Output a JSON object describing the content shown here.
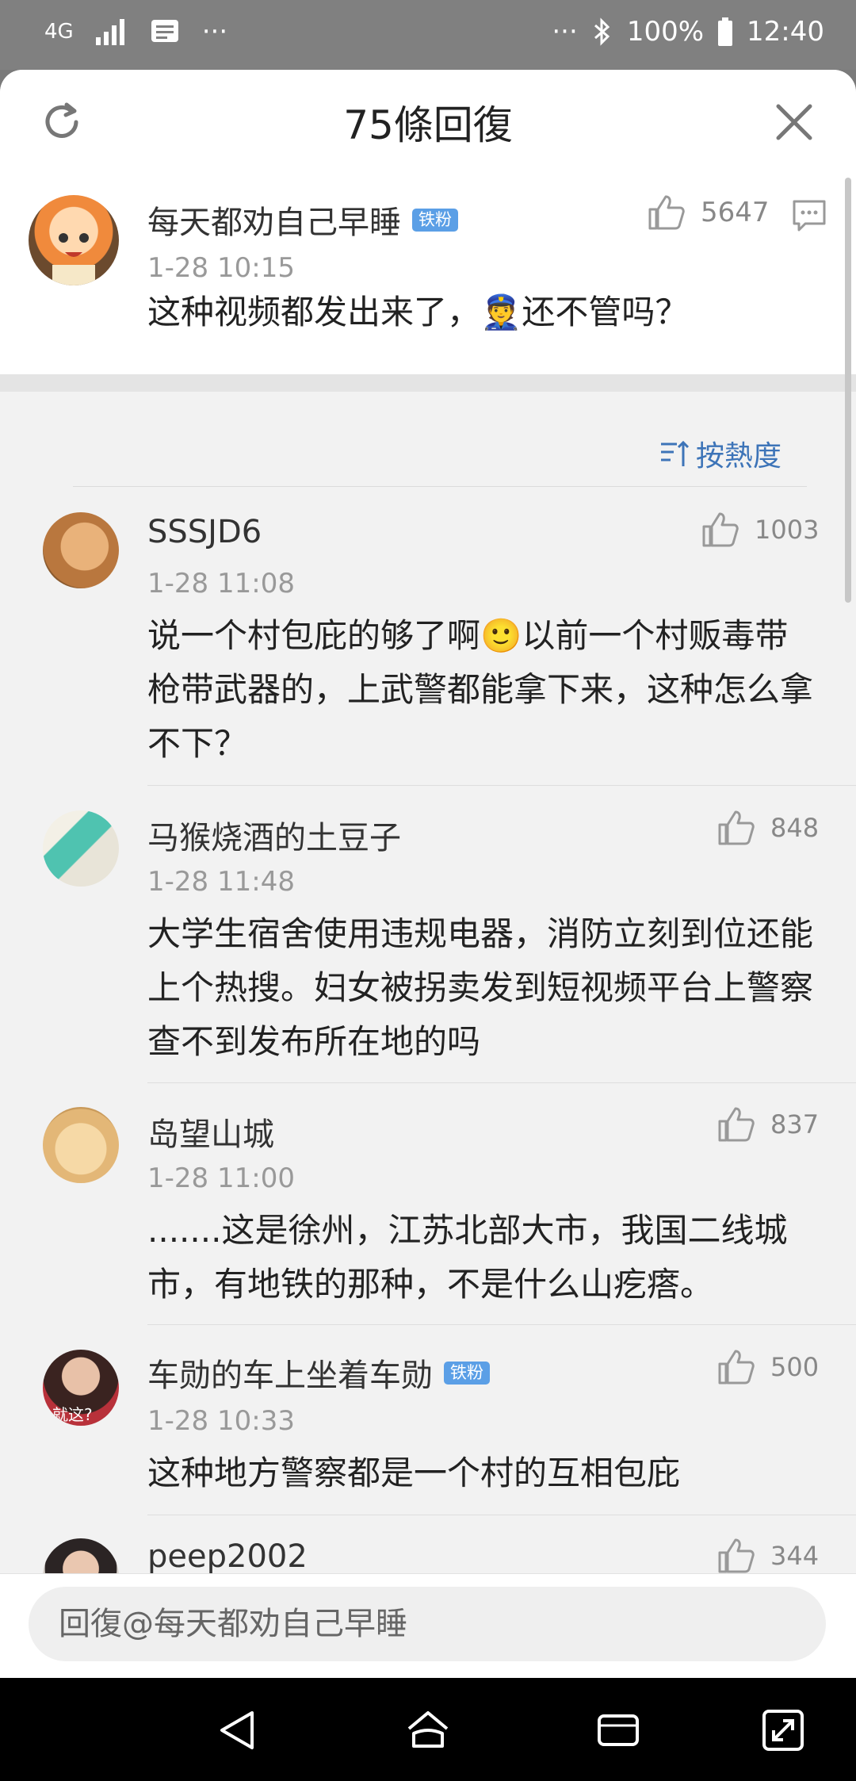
{
  "status_bar": {
    "network": "4G",
    "more_left": "···",
    "more_right": "···",
    "battery": "100%",
    "time": "12:40"
  },
  "header": {
    "title": "75條回復",
    "refresh_icon": "refresh-icon",
    "close_icon": "close-icon"
  },
  "main_comment": {
    "username": "每天都劝自己早睡",
    "badge": "铁粉",
    "time": "1-28 10:15",
    "likes": "5647",
    "text_before": "这种视频都发出来了，",
    "emoji": "👮",
    "text_after": "还不管吗？"
  },
  "sort": {
    "label": "按熱度",
    "icon": "sort-icon"
  },
  "replies": [
    {
      "username": "SSSJD6",
      "time": "1-28 11:08",
      "likes": "1003",
      "text_before": "说一个村包庇的够了啊",
      "emoji": "🙂",
      "text_after": "以前一个村贩毒带枪带武器的，上武警都能拿下来，这种怎么拿不下？"
    },
    {
      "username": "马猴烧酒的土豆子",
      "time": "1-28 11:48",
      "likes": "848",
      "text": "大学生宿舍使用违规电器，消防立刻到位还能上个热搜。妇女被拐卖发到短视频平台上警察查不到发布所在地的吗"
    },
    {
      "username": "岛望山城",
      "time": "1-28 11:00",
      "likes": "837",
      "text": ".......这是徐州，江苏北部大市，我国二线城市，有地铁的那种，不是什么山疙瘩。"
    },
    {
      "username": "车勋的车上坐着车勋",
      "badge": "铁粉",
      "avatar_caption": "就这?",
      "time": "1-28 10:33",
      "likes": "500",
      "text": "这种地方警察都是一个村的互相包庇"
    },
    {
      "username": "peep2002",
      "likes": "344"
    }
  ],
  "reply_bar": {
    "placeholder": "回復@每天都劝自己早睡"
  },
  "nav_bar": {
    "back": "back-icon",
    "home": "home-icon",
    "recents": "recents-icon",
    "rotate": "rotate-icon"
  }
}
